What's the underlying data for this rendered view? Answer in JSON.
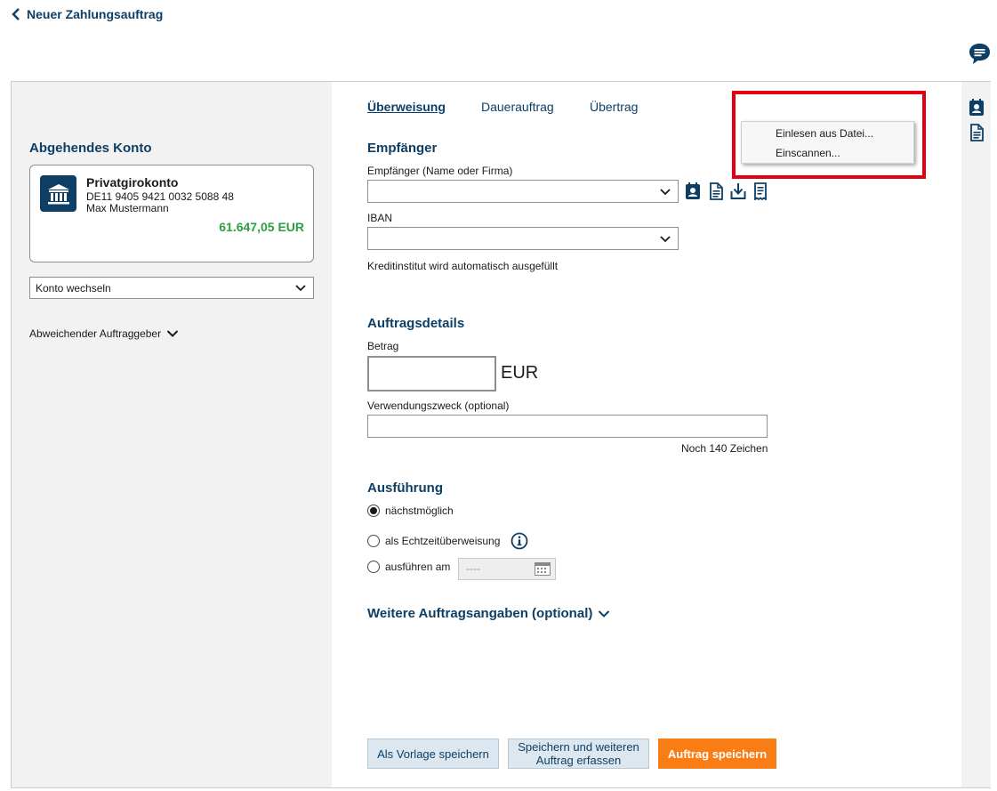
{
  "header": {
    "title": "Neuer Zahlungsauftrag"
  },
  "left": {
    "section_title": "Abgehendes Konto",
    "account": {
      "name": "Privatgirokonto",
      "iban": "DE11 9405 9421 0032 5088 48",
      "holder": "Max Mustermann",
      "balance": "61.647,05 EUR",
      "balance_color": "#2e9e43"
    },
    "switch_select_value": "Konto wechseln",
    "alt_payer_label": "Abweichender Auftraggeber"
  },
  "tabs": [
    {
      "label": "Überweisung",
      "active": true
    },
    {
      "label": "Dauerauftrag",
      "active": false
    },
    {
      "label": "Übertrag",
      "active": false
    }
  ],
  "recipient": {
    "section_title": "Empfänger",
    "name_label": "Empfänger (Name oder Firma)",
    "name_value": "",
    "iban_label": "IBAN",
    "iban_value": "",
    "bank_hint": "Kreditinstitut wird automatisch ausgefüllt",
    "icons": [
      "address-book-icon",
      "document-icon",
      "download-icon",
      "scan-receipt-icon"
    ]
  },
  "context_menu": {
    "items": [
      "Einlesen aus Datei...",
      "Einscannen..."
    ]
  },
  "details": {
    "section_title": "Auftragsdetails",
    "amount_label": "Betrag",
    "amount_value": "",
    "currency": "EUR",
    "purpose_label": "Verwendungszweck (optional)",
    "purpose_value": "",
    "chars_left": "Noch 140 Zeichen"
  },
  "execution": {
    "section_title": "Ausführung",
    "options": [
      {
        "label": "nächstmöglich",
        "selected": true
      },
      {
        "label": "als Echtzeitüberweisung",
        "selected": false
      },
      {
        "label": "ausführen am",
        "selected": false
      }
    ],
    "date_placeholder": "----"
  },
  "more": {
    "label": "Weitere Auftragsangaben (optional)"
  },
  "buttons": {
    "save_template": "Als Vorlage speichern",
    "save_and_new_line1": "Speichern und weiteren",
    "save_and_new_line2": "Auftrag erfassen",
    "save_order": "Auftrag speichern"
  },
  "colors": {
    "brand": "#0d3f66",
    "accent": "#f97d14",
    "highlight": "#e3000f"
  }
}
